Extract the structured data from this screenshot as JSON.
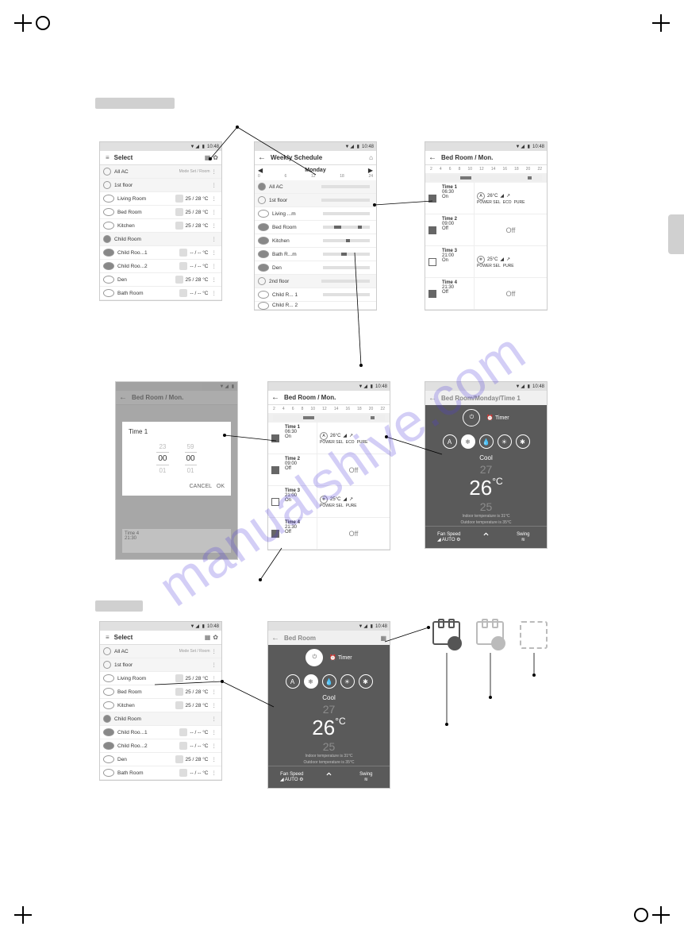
{
  "watermark": "manualshive.com",
  "status_time": "10:48",
  "screens": {
    "s1": {
      "title": "Select",
      "sublabel": "Mode   Set / Room",
      "groups": [
        {
          "name": "All AC"
        },
        {
          "name": "1st floor"
        }
      ],
      "rooms": [
        {
          "name": "Living Room",
          "temp": "25 / 28  °C"
        },
        {
          "name": "Bed Room",
          "temp": "25 / 28  °C"
        },
        {
          "name": "Kitchen",
          "temp": "25 / 28  °C"
        }
      ],
      "group2": "Child Room",
      "rooms2": [
        {
          "name": "Child Roo...1",
          "temp": "-- / --   °C"
        },
        {
          "name": "Child Roo...2",
          "temp": "-- / --   °C"
        },
        {
          "name": "Den",
          "temp": "25 / 28  °C"
        },
        {
          "name": "Bath Room",
          "temp": "-- / --   °C"
        }
      ]
    },
    "s2": {
      "title": "Weekly Schedule",
      "day": "Monday",
      "ticks": [
        "0",
        "6",
        "12",
        "18",
        "24"
      ],
      "rows": [
        "All AC",
        "1st floor",
        "Living ...m",
        "Bed Room",
        "Kitchen",
        "Bath R...m",
        "Den",
        "2nd floor",
        "Child R... 1",
        "Child R... 2"
      ]
    },
    "s3": {
      "title": "Bed Room / Mon.",
      "ticks": [
        "2",
        "4",
        "6",
        "8",
        "10",
        "12",
        "14",
        "16",
        "18",
        "20",
        "22"
      ],
      "times": [
        {
          "t": "Time 1",
          "h": "06:30",
          "s": "On",
          "mode": "A",
          "temp": "26°C",
          "eco": "ECO",
          "swing": "PURE"
        },
        {
          "t": "Time 2",
          "h": "09:00",
          "s": "Off",
          "off": true
        },
        {
          "t": "Time 3",
          "h": "21:00",
          "s": "On",
          "mode": "❄",
          "temp": "25°C",
          "eco": "",
          "swing": "PURE"
        },
        {
          "t": "Time 4",
          "h": "21:30",
          "s": "Off",
          "off": true
        }
      ]
    },
    "s4": {
      "title": "Bed Room / Mon.",
      "modal_title": "Time 1",
      "hours": [
        "23",
        "00",
        "01"
      ],
      "mins": [
        "59",
        "00",
        "01"
      ],
      "cancel": "CANCEL",
      "ok": "OK",
      "faded_time": "Time 4",
      "faded_h": "21:30"
    },
    "s6": {
      "title": "Bed Room/Monday/Time 1",
      "mode": "Cool",
      "up": "27",
      "main": "26",
      "deg": "°C",
      "down": "25",
      "note1": "Indoor temperature is   31°C",
      "note2": "Outdoor temperature is   35°C",
      "fan": "Fan Speed",
      "auto": "AUTO",
      "swing": "Swing",
      "timer": "Timer"
    },
    "s8": {
      "title": "Bed Room"
    }
  }
}
